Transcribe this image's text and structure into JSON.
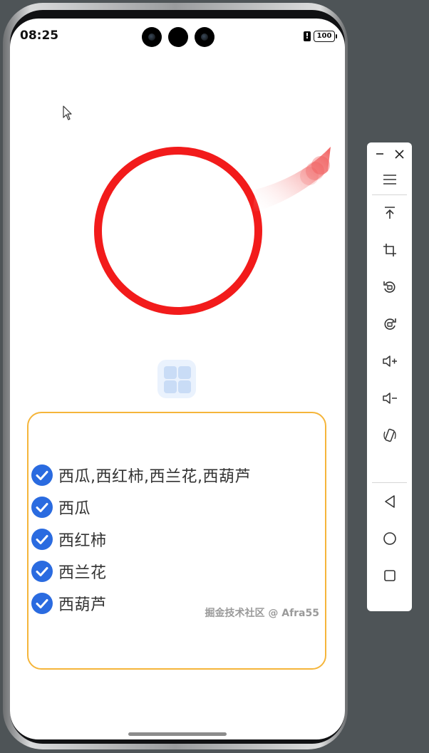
{
  "status_bar": {
    "time": "08:25",
    "battery": "100",
    "alert": "!"
  },
  "checkbox_group": {
    "items": [
      {
        "label": "西瓜,西红柿,西兰花,西葫芦",
        "checked": true
      },
      {
        "label": "西瓜",
        "checked": true
      },
      {
        "label": "西红柿",
        "checked": true
      },
      {
        "label": "西兰花",
        "checked": true
      },
      {
        "label": "西葫芦",
        "checked": true
      }
    ]
  },
  "watermark": "掘金技术社区 @ Afra55",
  "colors": {
    "ring": "#f21b1b",
    "check": "#2a6be0",
    "panel_border": "#f5b53a"
  },
  "emulator_toolbar": {
    "buttons": [
      "minimize-icon",
      "close-icon",
      "menu-icon",
      "pin-top-icon",
      "crop-icon",
      "rotate-left-icon",
      "rotate-right-icon",
      "volume-up-icon",
      "volume-down-icon",
      "shake-icon",
      "back-icon",
      "home-icon",
      "recent-apps-icon"
    ]
  }
}
